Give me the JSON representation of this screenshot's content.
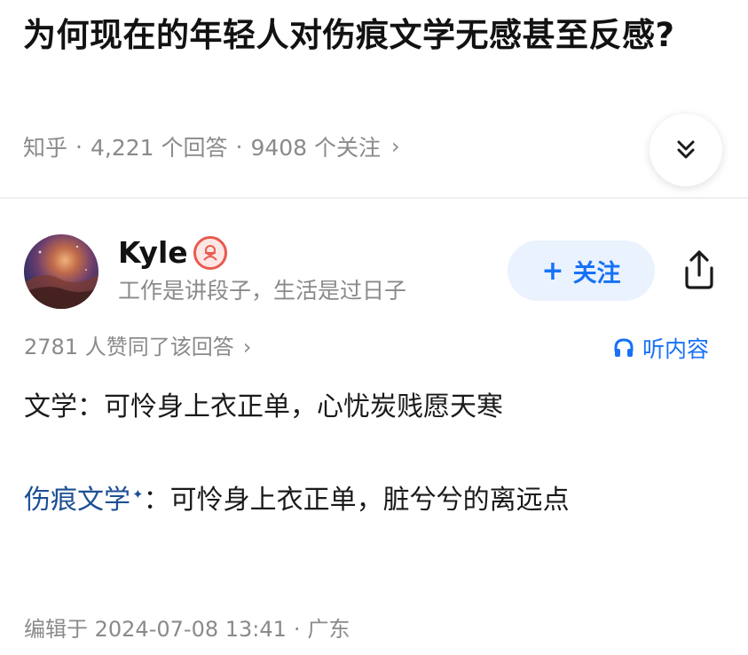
{
  "question": {
    "title": "为何现在的年轻人对伤痕文学无感甚至反感?",
    "source": "知乎",
    "answers_count": "4,221 个回答",
    "followers_count": "9408 个关注",
    "meta_chevron": "›"
  },
  "author": {
    "name": "Kyle",
    "bio": "工作是讲段子，生活是过日子",
    "follow_label": "关注",
    "follow_plus": "+"
  },
  "answer": {
    "upvote_text": "2781 人赞同了该回答",
    "upvote_chevron": "›",
    "listen_label": "听内容",
    "paragraph1": "文学：可怜身上衣正单，心忧炭贱愿天寒",
    "paragraph2_link": "伤痕文学",
    "paragraph2_link_mark": "✦",
    "paragraph2_rest": "：可怜身上衣正单，脏兮兮的离远点",
    "edited_at": "编辑于 2024-07-08 13:41",
    "location": "广东",
    "dot": "·"
  },
  "colors": {
    "accent": "#1772f6",
    "follow_bg": "#eaf2fe",
    "link": "#1d4f94",
    "meta_gray": "#8a8a8a",
    "badge_red": "#e85a4f"
  },
  "icons": {
    "collapse": "double-chevron-down-icon",
    "share": "share-icon",
    "listen": "headphones-icon",
    "badge": "author-badge-icon"
  }
}
